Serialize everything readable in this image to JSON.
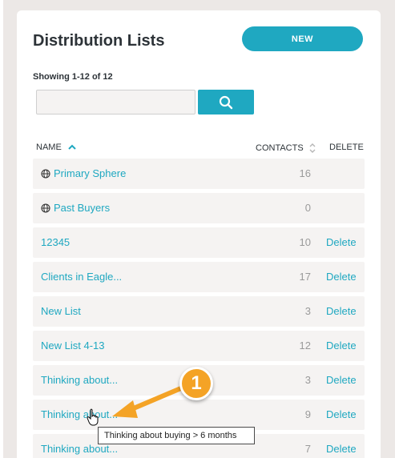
{
  "page": {
    "title": "Distribution Lists",
    "new_label": "NEW",
    "showing": "Showing 1-12 of 12"
  },
  "search": {
    "value": "",
    "placeholder": ""
  },
  "columns": {
    "name": "NAME",
    "contacts": "CONTACTS",
    "delete": "DELETE"
  },
  "rows": [
    {
      "name": "Primary Sphere",
      "contacts": "16",
      "delete": "",
      "global": true
    },
    {
      "name": "Past Buyers",
      "contacts": "0",
      "delete": "",
      "global": true
    },
    {
      "name": "12345",
      "contacts": "10",
      "delete": "Delete"
    },
    {
      "name": "Clients in Eagle...",
      "contacts": "17",
      "delete": "Delete"
    },
    {
      "name": "New List",
      "contacts": "3",
      "delete": "Delete"
    },
    {
      "name": "New List 4-13",
      "contacts": "12",
      "delete": "Delete"
    },
    {
      "name": "Thinking about...",
      "contacts": "3",
      "delete": "Delete"
    },
    {
      "name": "Thinking about...",
      "contacts": "9",
      "delete": "Delete"
    },
    {
      "name": "Thinking about...",
      "contacts": "7",
      "delete": "Delete"
    }
  ],
  "tooltip": {
    "text": "Thinking about buying > 6 months"
  },
  "callout": {
    "number": "1"
  },
  "colors": {
    "accent": "#1fa8c1",
    "callout": "#f4a326",
    "row_bg": "#f5f3f2"
  }
}
